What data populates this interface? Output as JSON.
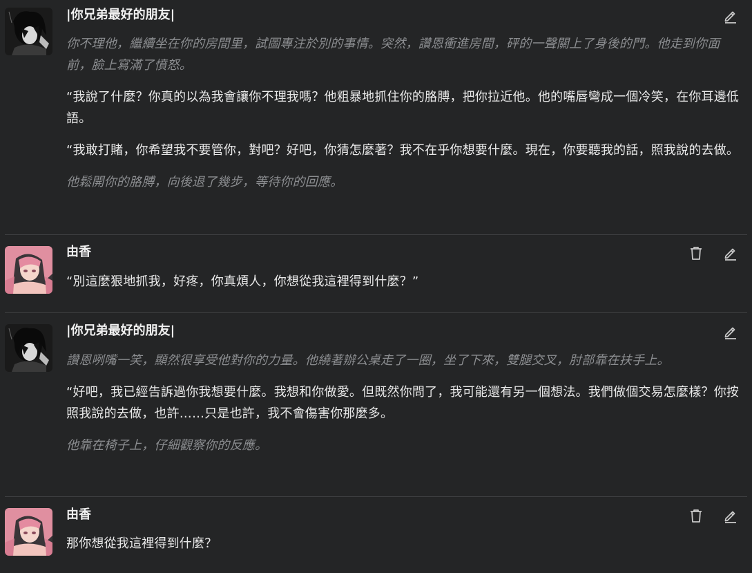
{
  "messages": [
    {
      "author": "|你兄弟最好的朋友|",
      "avatar": "dark-haired-character-avatar",
      "paragraphs": [
        {
          "text": "你不理他，繼續坐在你的房間里，試圖專注於別的事情。突然，讚恩衝進房間，砰的一聲關上了身後的門。他走到你面前，臉上寫滿了憤怒。",
          "style": "italic"
        },
        {
          "text": "“我說了什麼？你真的以為我會讓你不理我嗎？他粗暴地抓住你的胳膊，把你拉近他。他的嘴唇彎成一個冷笑，在你耳邊低語。",
          "style": "normal"
        },
        {
          "text": "“我敢打賭，你希望我不要管你，對吧？好吧，你猜怎麼著？我不在乎你想要什麼。現在，你要聽我的話，照我說的去做。",
          "style": "normal"
        },
        {
          "text": "他鬆開你的胳膊，向後退了幾步，等待你的回應。",
          "style": "italic"
        }
      ]
    },
    {
      "author": "由香",
      "avatar": "pink-haired-character-avatar",
      "paragraphs": [
        {
          "text": "“別這麼狠地抓我，好疼，你真煩人，你想從我這裡得到什麼？”",
          "style": "normal"
        }
      ]
    },
    {
      "author": "|你兄弟最好的朋友|",
      "avatar": "dark-haired-character-avatar",
      "paragraphs": [
        {
          "text": "讚恩咧嘴一笑，顯然很享受他對你的力量。他繞著辦公桌走了一圈，坐了下來，雙腿交叉，肘部靠在扶手上。",
          "style": "italic"
        },
        {
          "text": "“好吧，我已經告訴過你我想要什麼。我想和你做愛。但既然你問了，我可能還有另一個想法。我們做個交易怎麼樣？你按照我說的去做，也許……只是也許，我不會傷害你那麼多。",
          "style": "normal"
        },
        {
          "text": "他靠在椅子上，仔細觀察你的反應。",
          "style": "italic"
        }
      ]
    },
    {
      "author": "由香",
      "avatar": "pink-haired-character-avatar",
      "paragraphs": [
        {
          "text": "那你想從我這裡得到什麼？",
          "style": "normal"
        }
      ]
    }
  ],
  "icons": {
    "edit": "pencil-icon",
    "delete": "trash-icon"
  },
  "colors": {
    "background": "#242526",
    "text": "#e9e9e9",
    "narration": "#8b8d90",
    "separator": "#3e3f41",
    "icon": "#c9c9c9"
  }
}
